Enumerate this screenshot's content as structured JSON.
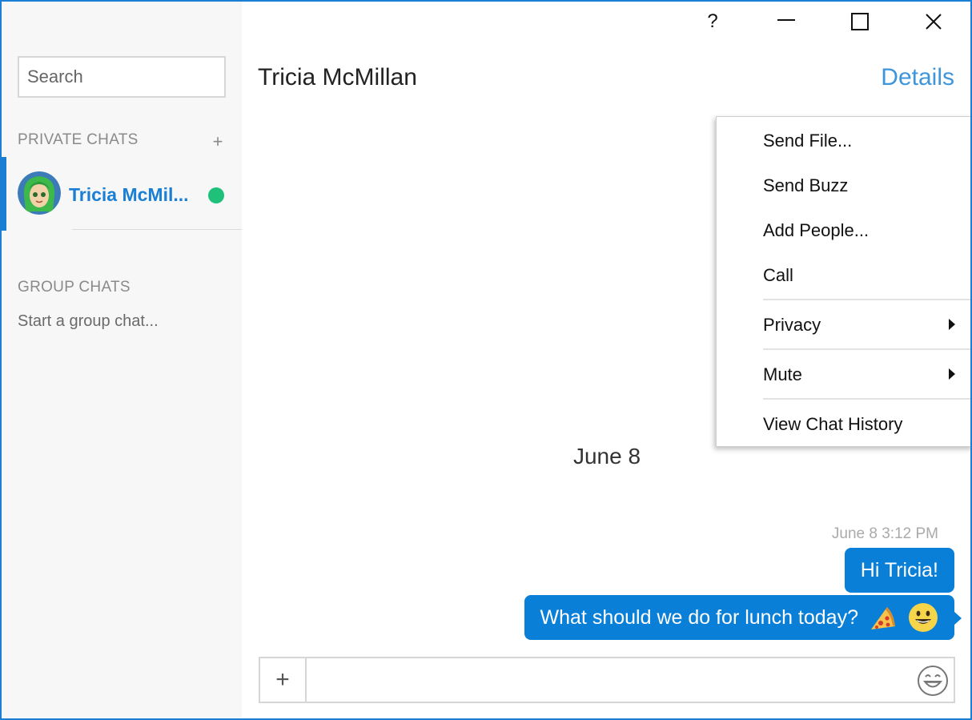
{
  "window": {
    "help_label": "?",
    "minimize_label": "—",
    "maximize_label": "☐",
    "close_label": "✕"
  },
  "sidebar": {
    "search_placeholder": "Search",
    "private_header": "PRIVATE CHATS",
    "add_private_label": "+",
    "chats": [
      {
        "name": "Tricia McMil...",
        "status": "online",
        "status_color": "#1fc07a"
      }
    ],
    "group_header": "GROUP CHATS",
    "start_group": "Start a group chat..."
  },
  "header": {
    "contact_name": "Tricia McMillan",
    "details_label": "Details"
  },
  "menu": {
    "items": [
      {
        "label": "Send File..."
      },
      {
        "label": "Send Buzz"
      },
      {
        "label": "Add People..."
      },
      {
        "label": "Call"
      },
      {
        "label": "Privacy",
        "submenu": true
      },
      {
        "label": "Mute",
        "submenu": true
      },
      {
        "label": "View Chat History"
      }
    ]
  },
  "conversation": {
    "date_separator": "June 8",
    "timestamp": "June 8 3:12 PM",
    "messages": [
      {
        "text": "Hi Tricia!"
      },
      {
        "text": "What should we do for lunch today?",
        "emojis": [
          "pizza-icon",
          "smiley-icon"
        ]
      }
    ]
  },
  "composer": {
    "add_label": "+",
    "input_placeholder": "",
    "emoji_icon": "emoji-grin-icon"
  },
  "colors": {
    "accent": "#1a7fd4",
    "bubble": "#0a7fd8",
    "details_link": "#3d95dc",
    "online": "#1fc07a"
  }
}
